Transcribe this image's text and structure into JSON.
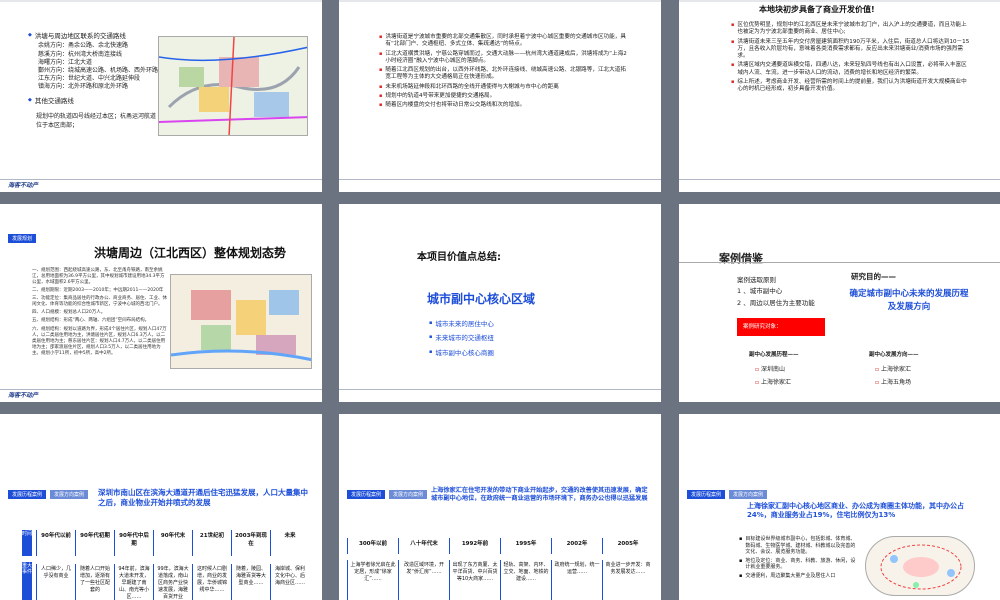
{
  "footer_logo": "海客不动产",
  "slide1": {
    "heading": "洪塘与周边地区联系的交通路线",
    "routes": [
      "余姚方向：甬余公路、余北快速路",
      "慈溪方向：杭州湾大桥南连接线",
      "海曙方向：江北大道",
      "鄞州方向：绕城高速公路、机场路、西外环路",
      "江东方向：世纪大道、中兴北路延伸段",
      "镇海方向：北外环路和原北外环路"
    ],
    "other_heading": "其他交通路线",
    "other_text": "规划中的轨道四号线经过本区；杭甬运河航道位于本区南部；"
  },
  "slide2": {
    "bullets": [
      "洪塘街道是宁波城市重要的北部交通集散区，同时承担着宁波中心城区重要的交通城市区功能，具有“北部门户、交通枢纽、多式立体、集疏通达”的特点。",
      "江北大道横贯洪塘，宁慈公路穿城而过，交通大动脉——杭州湾大通道建成后，洪塘将成为“上海2小时经济圈”融入宁波中心城区的落脚点。",
      "随着江北西区规划的出台，以西外环线路、北外环连接线、绕城高速公路、北银路等，江北大道拓宽工程等为主体的大交通格局正在快速形成。",
      "未来机场路延伸段和北环西路的全线开通使得与大榭城与市中心的距离",
      "规划中的轨道4号带来更加便捷的交通格局。",
      "随着区内楼盘的交付也将带动日常公交路线和次的增加。"
    ]
  },
  "slide3": {
    "heading": "本地块初步具备了商业开发价值!",
    "bullets": [
      "区位优势明显，规划中的江北西区是未来宁波城市北门户，出入沪上的交通要道，而且功能上也被定为为宁波北部重要的商业、居住中心;",
      "洪塘街道未来三至五年内交付房屋建筑面积约190万平米，入住后，街道总人口将达到10－15万，且各收入阶层均有，意味着各类消费需求都有，反应出未来洪塘商业/消费市场的强烈需求。",
      "洪塘区域内交通要道纵横交错，四通八达，未来轻轨四号线也有出入口设置，必将带入丰富区域内人流、车流，进一步带动人口的流动，消费的增长和地区经济的繁荣。",
      "综上所述，考虑商业开发、经营所需的时间上的提前量，我们认为洪塘街道开发大规模商业中心的时机已经形成，初步具备开发价值。"
    ]
  },
  "slide4": {
    "tag": "发展规划",
    "title": "洪塘周边（江北西区）整体规划态势",
    "items": [
      "一、规划范围：西起绕城高速公路，东、北至甬舟铁路，南至余姚江，总用地面积为36.9平方公里，其中规划城市建设用地34.3平方公里，水域面积2.6平方公里。",
      "二、规划期限：近期2003——2010年；中远期2011——2020年",
      "三、功能定位：集商品居住的行政办公、商业商务、居住、工业、休闲文化、体育等功能的综合性城市新区，宁波中心城的西北门户。",
      "四、人口规模：规划总人口20万人。",
      "五、规划结构：形成“两心、两轴、六组团”空间布局结构。",
      "六、规划结构：规划以道路为界，形成4个居住片区，规划人口47万人，以二类居住用地为主，洪塘居住片区，规划人口6.3万人，以二类居住用地为主；慈东居住片区：规划人口4.7万人，以二类居住用地为主；邵家渡居住片区，规划人口3.5万人，以二类居住用地为主。规划小学11所，初中5所，高中2所。"
    ]
  },
  "slide5": {
    "title": "本项目价值点总结:",
    "core": "城市副中心核心区域",
    "bullets": [
      "城市未来的居住中心",
      "未来城市的交通枢纽",
      "城市副中心核心商圈"
    ]
  },
  "slide6": {
    "title": "案例借鉴",
    "principle_heading": "案例选取原则",
    "principles": [
      "1 、城市副中心",
      "2 、周边以居住为主要功能"
    ],
    "red_box": "案例研究对象：",
    "purpose_heading": "研究目的——",
    "purpose": "确定城市副中心未来的发展历程及发展方向",
    "history_heading": "副中心发展历程——",
    "history_cases": [
      "深圳南山",
      "上海徐家汇"
    ],
    "direction_heading": "副中心发展方向——",
    "direction_cases": [
      "上海徐家汇",
      "上海五角场"
    ]
  },
  "slide7": {
    "tags": [
      "发展历程案例",
      "发展方向案例"
    ],
    "title": "深圳市南山区在滨海大通道开通后住宅迅猛发展，人口大量集中之后，商业物业开始井喷式的发展",
    "row_head": "时间",
    "row_head2": "重大事件",
    "periods": [
      "90年代以前",
      "90年代初期",
      "90年代中后期",
      "90年代末",
      "21世纪初",
      "2003年到现在",
      "未来"
    ],
    "events": [
      "人口稀少，几乎没有商业",
      "随着人口开始增加，逐渐有了一些社区配套的",
      "94年前，滨海大道未开发，早期建了南山、南光等小区……",
      "99年，滨海大道落成，南山区商务产业快速发展，海雅百货开业",
      "这时候人口剧增，商业的发展，华侨城锦绣中华……",
      "随着，陵园、海雅百货等大型商业……",
      "海岸城、保利文化中心、后海商业区……"
    ]
  },
  "slide8": {
    "tags": [
      "发展历程案例",
      "发展方向案例"
    ],
    "title": "上海徐家汇在住宅开发的带动下商业开始起步，交通的改善使其迅速发展，确定城市副中心地位，在政府统一商业运营的市场环境下，商务办公也得以迅猛发展",
    "years": [
      "300年以前",
      "八十年代末",
      "1992年前",
      "1995年",
      "2002年",
      "2005年"
    ],
    "events": [
      "上海学者徐光启在此定居，形成“徐家汇”……",
      "改造区域环境，开发“侨汇房”……",
      "出现了东方商厦、太平洋百货、中兴百货等10大商家……",
      "轻轨、高架、内环、立交、地面、地铁的建设……",
      "政府统一规划，统一运营……",
      "商业进一步开发：商务发展发达……"
    ]
  },
  "slide9": {
    "tags": [
      "发展历程案例",
      "发展方向案例"
    ],
    "title": "上海徐家汇副中心核心地区商业、办公成为商圈主体功能，其中办公占24%，商业服务业占19%，住宅比例仅为13%",
    "bullets": [
      "目标建设世界级城市副中心，包括影城、体育城、数码城、生物医学城、建材城、科教城以及完善的文化、会议、展览服务功能。",
      "地位及定位：商业、商务、科教、旅游、休闲，设计就业重要服务。",
      "交通便利，周边聚集大量产业及居住人口"
    ]
  }
}
